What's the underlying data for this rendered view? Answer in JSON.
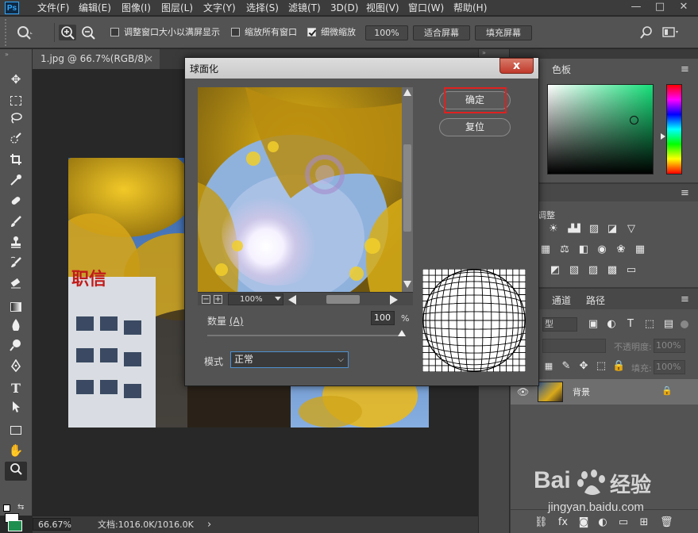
{
  "app": {
    "logo": "Ps"
  },
  "menu": [
    "文件(F)",
    "编辑(E)",
    "图像(I)",
    "图层(L)",
    "文字(Y)",
    "选择(S)",
    "滤镜(T)",
    "3D(D)",
    "视图(V)",
    "窗口(W)",
    "帮助(H)"
  ],
  "window_controls": {
    "minimize": "—",
    "restore": "□",
    "close": "✕"
  },
  "options_bar": {
    "resize_window_label": "调整窗口大小以满屏显示",
    "resize_window_checked": false,
    "zoom_all_label": "缩放所有窗口",
    "zoom_all_checked": false,
    "scrubby_zoom_label": "细微缩放",
    "scrubby_zoom_checked": true,
    "btn_100": "100%",
    "btn_fit": "适合屏幕",
    "btn_fill": "填充屏幕"
  },
  "document_tab": {
    "title": "1.jpg @ 66.7%(RGB/8)",
    "close": "×"
  },
  "status_bar": {
    "zoom": "66.67%",
    "doc_info": "文档:1016.0K/1016.0K",
    "arrow": "›"
  },
  "panels": {
    "color_tab": "色板",
    "adjust_label": "调整",
    "channels_tab": "通道",
    "paths_tab": "路径",
    "kind_label": "型",
    "opacity_label": "不透明度:",
    "opacity_value": "100%",
    "fill_label": "填充:",
    "fill_value": "100%",
    "layer_name": "背景"
  },
  "dialog": {
    "title": "球面化",
    "close": "x",
    "ok": "确定",
    "reset": "复位",
    "zoom_value": "100%",
    "amount_label": "数量",
    "amount_hotkey": "(A)",
    "amount_value": "100",
    "amount_unit": "%",
    "amount_fraction": 1.0,
    "mode_label": "模式",
    "mode_value": "正常"
  },
  "watermark": {
    "brand": "Bai",
    "brand2": "经验",
    "url": "jingyan.baidu.com"
  },
  "colors": {
    "highlight_box": "#e02020",
    "accent_blue": "#31a8ff",
    "foreground": "#ffffff",
    "background": "#1e8f4e"
  }
}
